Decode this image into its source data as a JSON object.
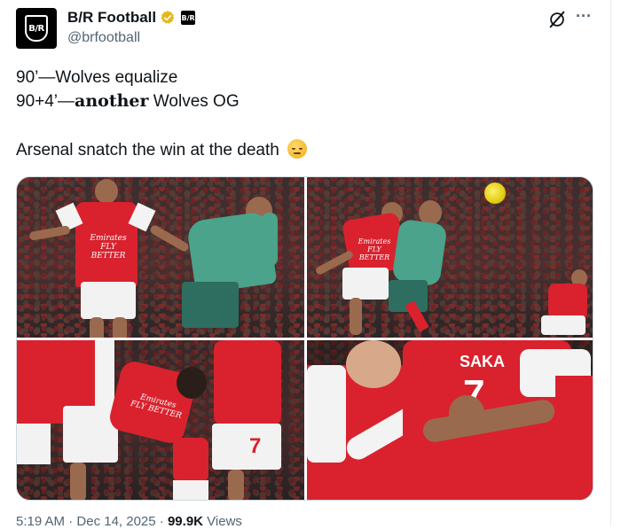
{
  "account": {
    "display_name": "B/R Football",
    "handle": "@brfootball",
    "avatar_text": "B/R",
    "affiliate_badge_text": "B/R"
  },
  "tweet": {
    "line1": "90’—Wolves equalize",
    "line2_prefix": "90+4’—",
    "line2_bold": "another",
    "line2_suffix": " Wolves OG",
    "line3": "Arsenal snatch the win at the death",
    "emoji": "relieved-sad-face"
  },
  "media": {
    "photos": [
      {
        "sponsor": "Emirates FLY BETTER"
      },
      {
        "sponsor": "Emirates FLY BETTER"
      },
      {
        "sponsor": "Emirates FLY BETTER"
      },
      {
        "name_on_shirt": "SAKA",
        "number": "7"
      }
    ]
  },
  "meta": {
    "time": "5:19 AM",
    "date": "Dec 14, 2025",
    "views": "99.9K",
    "views_label": "Views"
  },
  "colors": {
    "text_primary": "#0f1419",
    "text_secondary": "#536471",
    "verified_gold": "#e2b719",
    "arsenal_red": "#d9222e",
    "wolves_teal": "#4aa38a"
  },
  "icons": {
    "grok": "grok-icon",
    "more": "more-options-icon",
    "verified": "verified-badge-icon"
  }
}
